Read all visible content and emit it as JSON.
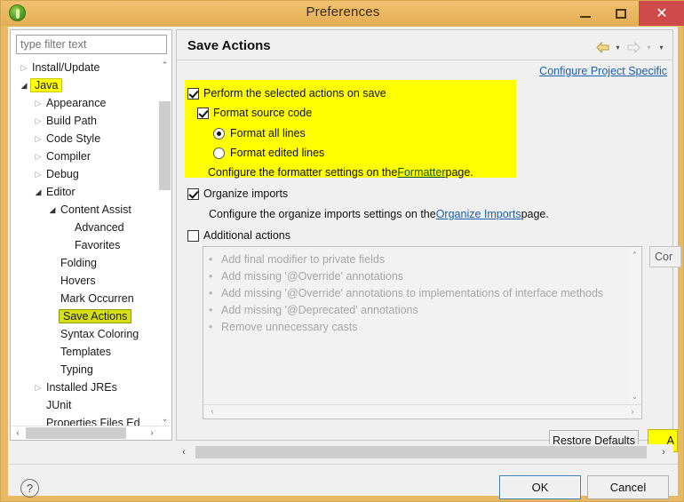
{
  "window": {
    "title": "Preferences",
    "app_icon": "eclipse-icon",
    "minimize_label": "–",
    "maximize_label": "□",
    "close_label": "✕",
    "close_color": "#cf4b4b",
    "titlebar_color": "#e9b75f"
  },
  "sidebar": {
    "filter": {
      "value": "",
      "placeholder": "type filter text"
    },
    "items": [
      {
        "label": "Install/Update",
        "depth": 0,
        "state": "collapsed",
        "highlight": "none"
      },
      {
        "label": "Java",
        "depth": 0,
        "state": "expanded",
        "highlight": "yellow"
      },
      {
        "label": "Appearance",
        "depth": 1,
        "state": "collapsed",
        "highlight": "none"
      },
      {
        "label": "Build Path",
        "depth": 1,
        "state": "collapsed",
        "highlight": "none"
      },
      {
        "label": "Code Style",
        "depth": 1,
        "state": "collapsed",
        "highlight": "none"
      },
      {
        "label": "Compiler",
        "depth": 1,
        "state": "collapsed",
        "highlight": "none"
      },
      {
        "label": "Debug",
        "depth": 1,
        "state": "collapsed",
        "highlight": "none"
      },
      {
        "label": "Editor",
        "depth": 1,
        "state": "expanded",
        "highlight": "none"
      },
      {
        "label": "Content Assist",
        "depth": 2,
        "state": "expanded",
        "highlight": "none"
      },
      {
        "label": "Advanced",
        "depth": 3,
        "state": "leaf",
        "highlight": "none"
      },
      {
        "label": "Favorites",
        "depth": 3,
        "state": "leaf",
        "highlight": "none"
      },
      {
        "label": "Folding",
        "depth": 2,
        "state": "leaf",
        "highlight": "none"
      },
      {
        "label": "Hovers",
        "depth": 2,
        "state": "leaf",
        "highlight": "none"
      },
      {
        "label": "Mark Occurren",
        "depth": 2,
        "state": "leaf",
        "highlight": "none"
      },
      {
        "label": "Save Actions",
        "depth": 2,
        "state": "leaf",
        "highlight": "green"
      },
      {
        "label": "Syntax Coloring",
        "depth": 2,
        "state": "leaf",
        "highlight": "none"
      },
      {
        "label": "Templates",
        "depth": 2,
        "state": "leaf",
        "highlight": "none"
      },
      {
        "label": "Typing",
        "depth": 2,
        "state": "leaf",
        "highlight": "none"
      },
      {
        "label": "Installed JREs",
        "depth": 1,
        "state": "collapsed",
        "highlight": "none"
      },
      {
        "label": "JUnit",
        "depth": 1,
        "state": "leaf",
        "highlight": "none"
      },
      {
        "label": "Properties Files Ed",
        "depth": 1,
        "state": "leaf",
        "highlight": "none"
      }
    ],
    "scroll_up": "⌃",
    "scroll_down": "⌄",
    "scroll_left": "‹",
    "scroll_right": "›"
  },
  "main": {
    "page_title": "Save Actions",
    "project_specific_link": "Configure Project Specific",
    "nav": {
      "back_icon": "arrow-left-icon",
      "back_caret": "▾",
      "forward_icon": "arrow-right-icon",
      "forward_caret": "▾",
      "menu_caret": "▾"
    },
    "highlight_color": "#ffff00",
    "perform_on_save": {
      "label": "Perform the selected actions on save",
      "checked": true
    },
    "format_source": {
      "label": "Format source code",
      "checked": true
    },
    "format_all_lines": {
      "label": "Format all lines",
      "selected": true
    },
    "format_edited_lines": {
      "label": "Format edited lines",
      "selected": false
    },
    "formatter_note": {
      "prefix": "Configure the formatter settings on the ",
      "link": "Formatter",
      "suffix": " page."
    },
    "organize_imports": {
      "label": "Organize imports",
      "checked": true
    },
    "organize_note": {
      "prefix": "Configure the organize imports settings on the ",
      "link": "Organize Imports",
      "suffix": " page."
    },
    "additional_actions": {
      "label": "Additional actions",
      "checked": false
    },
    "actions_list": [
      "Add final modifier to private fields",
      "Add missing '@Override' annotations",
      "Add missing '@Override' annotations to implementations of interface methods",
      "Add missing '@Deprecated' annotations",
      "Remove unnecessary casts"
    ],
    "configure_button": "Cor",
    "restore_defaults_button": "Restore Defaults",
    "apply_button": "A",
    "scroll_up": "⌃",
    "scroll_down": "⌄",
    "scroll_left": "‹",
    "scroll_right": "›"
  },
  "footer": {
    "help_icon": "question-mark-icon",
    "help_glyph": "?",
    "ok_button": "OK",
    "cancel_button": "Cancel"
  }
}
